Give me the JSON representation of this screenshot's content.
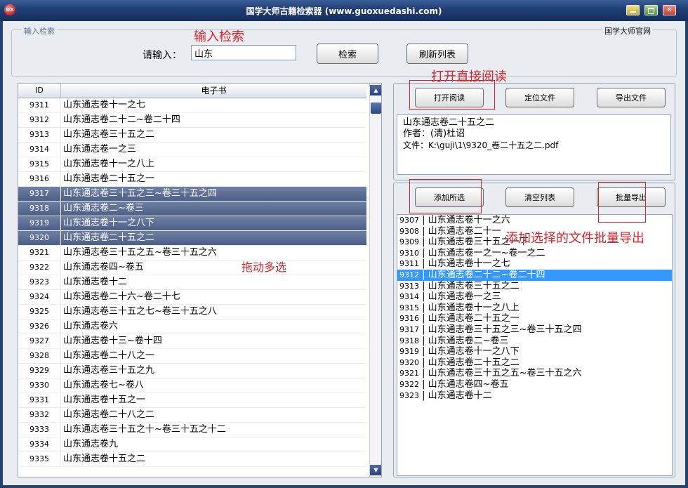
{
  "window": {
    "title": "国学大师古籍检索器 (www.guoxuedashi.com)",
    "icon_text": "DX"
  },
  "search": {
    "group_label": "输入检索",
    "official_link": "国学大师官网",
    "input_label": "请输入：",
    "input_value": "山东",
    "search_button": "检索",
    "refresh_button": "刷新列表"
  },
  "book_list": {
    "header_id": "ID",
    "header_book": "电子书",
    "rows": [
      {
        "id": "9311",
        "name": "山东通志卷十一之七",
        "selected": false
      },
      {
        "id": "9312",
        "name": "山东通志卷二十二~卷二十四",
        "selected": false
      },
      {
        "id": "9313",
        "name": "山东通志卷三十五之二",
        "selected": false
      },
      {
        "id": "9314",
        "name": "山东通志卷一之三",
        "selected": false
      },
      {
        "id": "9315",
        "name": "山东通志卷十一之八上",
        "selected": false
      },
      {
        "id": "9316",
        "name": "山东通志卷二十五之一",
        "selected": false
      },
      {
        "id": "9317",
        "name": "山东通志卷三十五之三~卷三十五之四",
        "selected": true
      },
      {
        "id": "9318",
        "name": "山东通志卷二~卷三",
        "selected": true
      },
      {
        "id": "9319",
        "name": "山东通志卷十一之八下",
        "selected": true
      },
      {
        "id": "9320",
        "name": "山东通志卷二十五之二",
        "selected": true
      },
      {
        "id": "9321",
        "name": "山东通志卷三十五之五~卷三十五之六",
        "selected": false
      },
      {
        "id": "9322",
        "name": "山东通志卷四~卷五",
        "selected": false
      },
      {
        "id": "9323",
        "name": "山东通志卷十二",
        "selected": false
      },
      {
        "id": "9324",
        "name": "山东通志卷二十六~卷二十七",
        "selected": false
      },
      {
        "id": "9325",
        "name": "山东通志卷三十五之七~卷三十五之八",
        "selected": false
      },
      {
        "id": "9326",
        "name": "山东通志卷六",
        "selected": false
      },
      {
        "id": "9327",
        "name": "山东通志卷十三~卷十四",
        "selected": false
      },
      {
        "id": "9328",
        "name": "山东通志卷二十八之一",
        "selected": false
      },
      {
        "id": "9329",
        "name": "山东通志卷三十五之九",
        "selected": false
      },
      {
        "id": "9330",
        "name": "山东通志卷七~卷八",
        "selected": false
      },
      {
        "id": "9331",
        "name": "山东通志卷十五之一",
        "selected": false
      },
      {
        "id": "9332",
        "name": "山东通志卷二十八之二",
        "selected": false
      },
      {
        "id": "9333",
        "name": "山东通志卷三十五之十~卷三十五之十二",
        "selected": false
      },
      {
        "id": "9334",
        "name": "山东通志卷九",
        "selected": false
      },
      {
        "id": "9335",
        "name": "山东通志卷十五之二",
        "selected": false
      }
    ]
  },
  "actions": {
    "open_read": "打开阅读",
    "locate_file": "定位文件",
    "export_file": "导出文件",
    "add_selected": "添加所选",
    "clear_list": "清空列表",
    "batch_export": "批量导出"
  },
  "info": {
    "title": "山东通志卷二十五之二",
    "author": "作者：(清)杜诏",
    "file": "文件：K:\\guji\\1\\9320_卷二十五之二.pdf"
  },
  "selected_list": {
    "items": [
      {
        "id": "9307",
        "name": "山东通志卷十一之六",
        "selected": false
      },
      {
        "id": "9308",
        "name": "山东通志卷二十一",
        "selected": false
      },
      {
        "id": "9309",
        "name": "山东通志卷三十五之一下",
        "selected": false
      },
      {
        "id": "9310",
        "name": "山东通志卷一之一~卷一之二",
        "selected": false
      },
      {
        "id": "9311",
        "name": "山东通志卷十一之七",
        "selected": false
      },
      {
        "id": "9312",
        "name": "山东通志卷二十二~卷二十四",
        "selected": true
      },
      {
        "id": "9313",
        "name": "山东通志卷三十五之二",
        "selected": false
      },
      {
        "id": "9314",
        "name": "山东通志卷一之三",
        "selected": false
      },
      {
        "id": "9315",
        "name": "山东通志卷十一之八上",
        "selected": false
      },
      {
        "id": "9316",
        "name": "山东通志卷二十五之一",
        "selected": false
      },
      {
        "id": "9317",
        "name": "山东通志卷三十五之三~卷三十五之四",
        "selected": false
      },
      {
        "id": "9318",
        "name": "山东通志卷二~卷三",
        "selected": false
      },
      {
        "id": "9319",
        "name": "山东通志卷十一之八下",
        "selected": false
      },
      {
        "id": "9320",
        "name": "山东通志卷二十五之二",
        "selected": false
      },
      {
        "id": "9321",
        "name": "山东通志卷三十五之五~卷三十五之六",
        "selected": false
      },
      {
        "id": "9322",
        "name": "山东通志卷四~卷五",
        "selected": false
      },
      {
        "id": "9323",
        "name": "山东通志卷十二",
        "selected": false
      }
    ]
  },
  "annotations": {
    "input_search": "输入检索",
    "open_direct": "打开直接阅读",
    "drag_multi": "拖动多选",
    "batch_export_note": "添加选择的文件批量导出"
  }
}
